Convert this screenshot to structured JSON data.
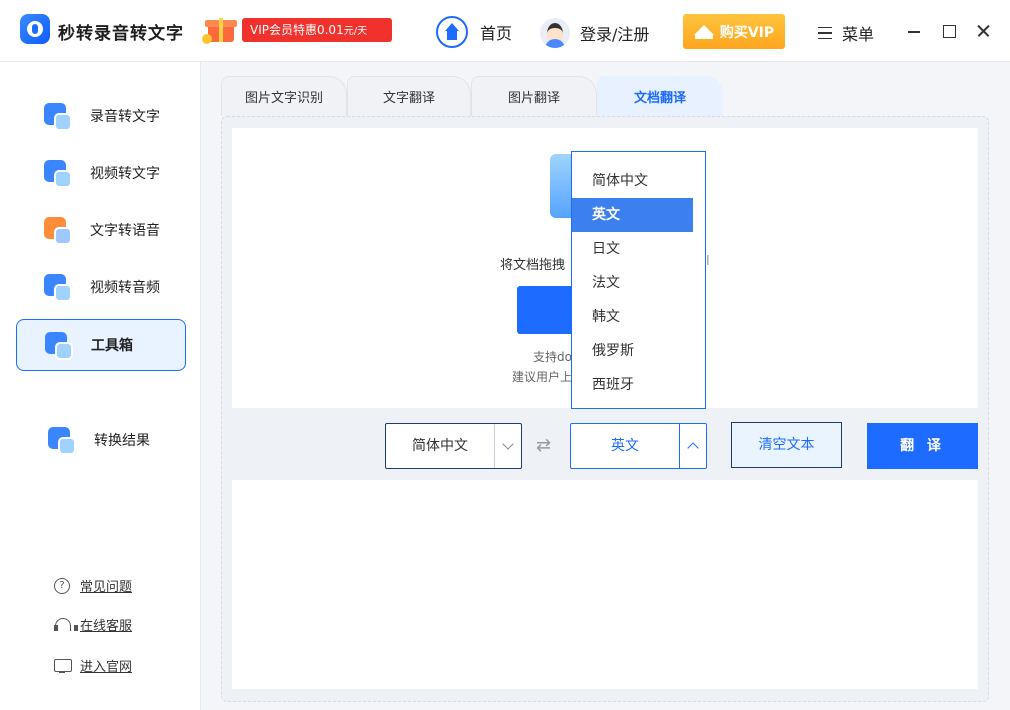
{
  "app": {
    "title": "秒转录音转文字",
    "vip_promo": "VIP会员特惠0.01",
    "vip_promo_unit": "元/天"
  },
  "nav": {
    "home": "首页",
    "login": "登录/注册",
    "buy_vip": "购买VIP",
    "menu": "菜单"
  },
  "sidebar": {
    "items": [
      {
        "label": "录音转文字"
      },
      {
        "label": "视频转文字"
      },
      {
        "label": "文字转语音"
      },
      {
        "label": "视频转音频"
      },
      {
        "label": "工具箱"
      },
      {
        "label": "转换结果"
      }
    ],
    "footer": [
      {
        "label": "常见问题"
      },
      {
        "label": "在线客服"
      },
      {
        "label": "进入官网"
      }
    ]
  },
  "tabs": [
    {
      "label": "图片文字识别"
    },
    {
      "label": "文字翻译"
    },
    {
      "label": "图片翻译"
    },
    {
      "label": "文档翻译"
    }
  ],
  "drop_zone": {
    "hint": "将文档拖拽",
    "hint_tail": "l",
    "support": "支持do",
    "suggest": "建议用户上"
  },
  "controls": {
    "source_lang": "简体中文",
    "target_lang": "英文",
    "clear": "清空文本",
    "translate": "翻 译"
  },
  "dropdown": {
    "options": [
      "简体中文",
      "英文",
      "日文",
      "法文",
      "韩文",
      "俄罗斯",
      "西班牙"
    ],
    "selected": "英文"
  },
  "colors": {
    "accent": "#1d6bff",
    "vip_red": "#f0312c",
    "vip_gold": "#ffb22a"
  }
}
